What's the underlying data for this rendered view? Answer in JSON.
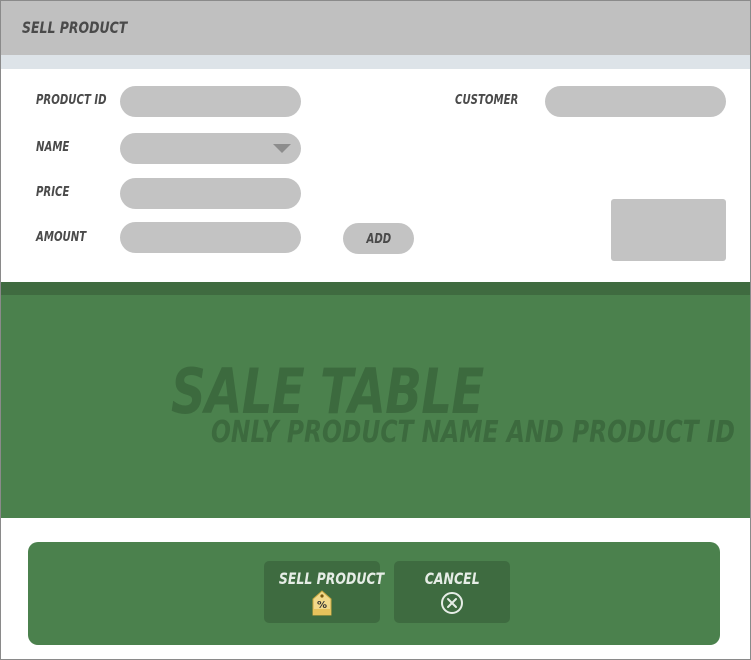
{
  "window": {
    "title": "SELL PRODUCT"
  },
  "form": {
    "product_id": {
      "label": "PRODUCT ID",
      "value": ""
    },
    "name": {
      "label": "NAME",
      "value": ""
    },
    "price": {
      "label": "PRICE",
      "value": ""
    },
    "amount": {
      "label": "AMOUNT",
      "value": ""
    },
    "customer": {
      "label": "CUSTOMER",
      "value": ""
    },
    "add_button": "ADD"
  },
  "sale_table": {
    "title": "SALE TABLE",
    "subtitle": "ONLY PRODUCT NAME AND PRODUCT ID"
  },
  "footer": {
    "sell_button": {
      "label": "SELL PRODUCT",
      "icon": "price-tag-percent-icon"
    },
    "cancel_button": {
      "label": "CANCEL",
      "icon": "cancel-circle-icon"
    }
  },
  "colors": {
    "header_gray": "#c0c0c0",
    "field_gray": "#c3c3c3",
    "green_panel": "#4b814d",
    "dark_green": "#3e6b40"
  }
}
